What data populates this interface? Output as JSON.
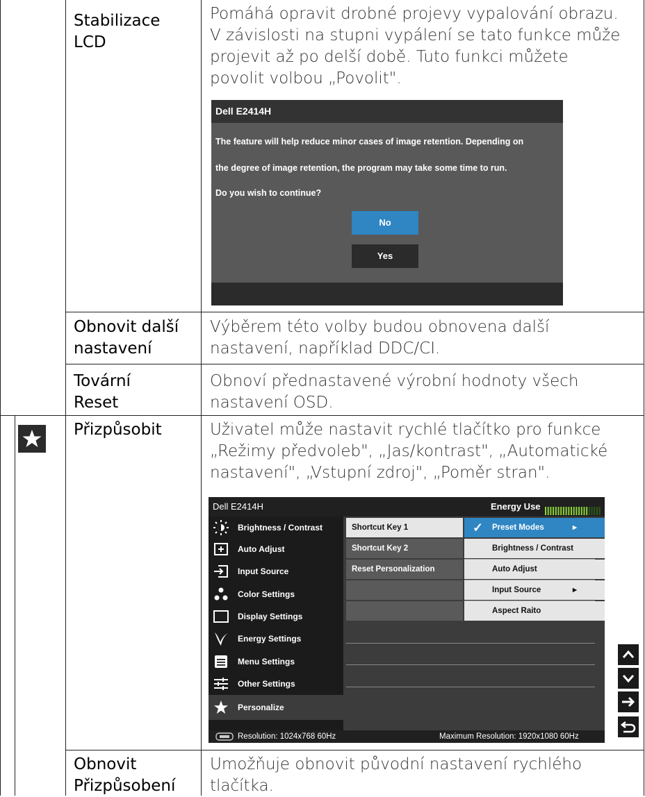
{
  "rows": [
    {
      "label": [
        "Stabilizace",
        "LCD"
      ],
      "desc": [
        "Pomáhá opravit drobné projevy vypalování obrazu.",
        "V závislosti na stupni vypálení se tato funkce může",
        "projevit až po delší době. Tuto funkci můžete",
        "povolit volbou „Povolit\"."
      ]
    },
    {
      "label": [
        "Obnovit další",
        "nastavení"
      ],
      "desc": [
        "Výběrem této volby budou obnovena další",
        "nastavení, například DDC/CI."
      ]
    },
    {
      "label": [
        "Tovární",
        "Reset"
      ],
      "desc": [
        "Obnoví přednastavené výrobní hodnoty všech",
        "nastavení OSD."
      ]
    },
    {
      "label": [
        "Přizpůsobit"
      ],
      "desc": [
        "Uživatel může nastavit rychlé tlačítko pro funkce",
        "„Režimy předvoleb\", „Jas/kontrast\", „Automatické",
        "nastavení\", „Vstupní zdroj\", „Poměr stran\"."
      ]
    },
    {
      "label": [
        "Obnovit",
        "Přizpůsobení"
      ],
      "desc": [
        "Umožňuje obnovit původní nastavení rychlého",
        "tlačítka."
      ]
    }
  ],
  "dialog": {
    "title": "Dell E2414H",
    "lines": [
      "The feature will help reduce minor cases of image retention. Depending on",
      "the degree of image retention, the program may take some time to run.",
      "Do you wish to continue?"
    ],
    "no_label": "No",
    "yes_label": "Yes"
  },
  "osd": {
    "title": "Dell E2414H",
    "energy_label": "Energy Use",
    "energy_level_fraction": 0.75,
    "menu": [
      {
        "icon": "brightness-icon",
        "label": "Brightness / Contrast"
      },
      {
        "icon": "auto-adjust-icon",
        "label": "Auto Adjust"
      },
      {
        "icon": "input-source-icon",
        "label": "Input Source"
      },
      {
        "icon": "color-settings-icon",
        "label": "Color Settings"
      },
      {
        "icon": "display-settings-icon",
        "label": "Display Settings"
      },
      {
        "icon": "energy-settings-icon",
        "label": "Energy Settings"
      },
      {
        "icon": "menu-settings-icon",
        "label": "Menu Settings"
      },
      {
        "icon": "other-settings-icon",
        "label": "Other Settings"
      },
      {
        "icon": "star-icon",
        "label": "Personalize"
      }
    ],
    "submenu": [
      "Shortcut Key 1",
      "Shortcut Key 2",
      "Reset Personalization"
    ],
    "options": [
      "Preset Modes",
      "Brightness / Contrast",
      "Auto Adjust",
      "Input Source",
      "Aspect Raito"
    ],
    "resolution": "Resolution:  1024x768 60Hz",
    "max_resolution": "Maximum Resolution: 1920x1080 60Hz",
    "check_glyph": "✓",
    "arrow_glyph": "▸"
  },
  "nav": [
    "up-icon",
    "down-icon",
    "right-arrow-icon",
    "back-icon"
  ],
  "colors": {
    "highlight": "#2f86c3",
    "dialog_bg": "#595959",
    "osd_left": "#1b1b1b"
  }
}
